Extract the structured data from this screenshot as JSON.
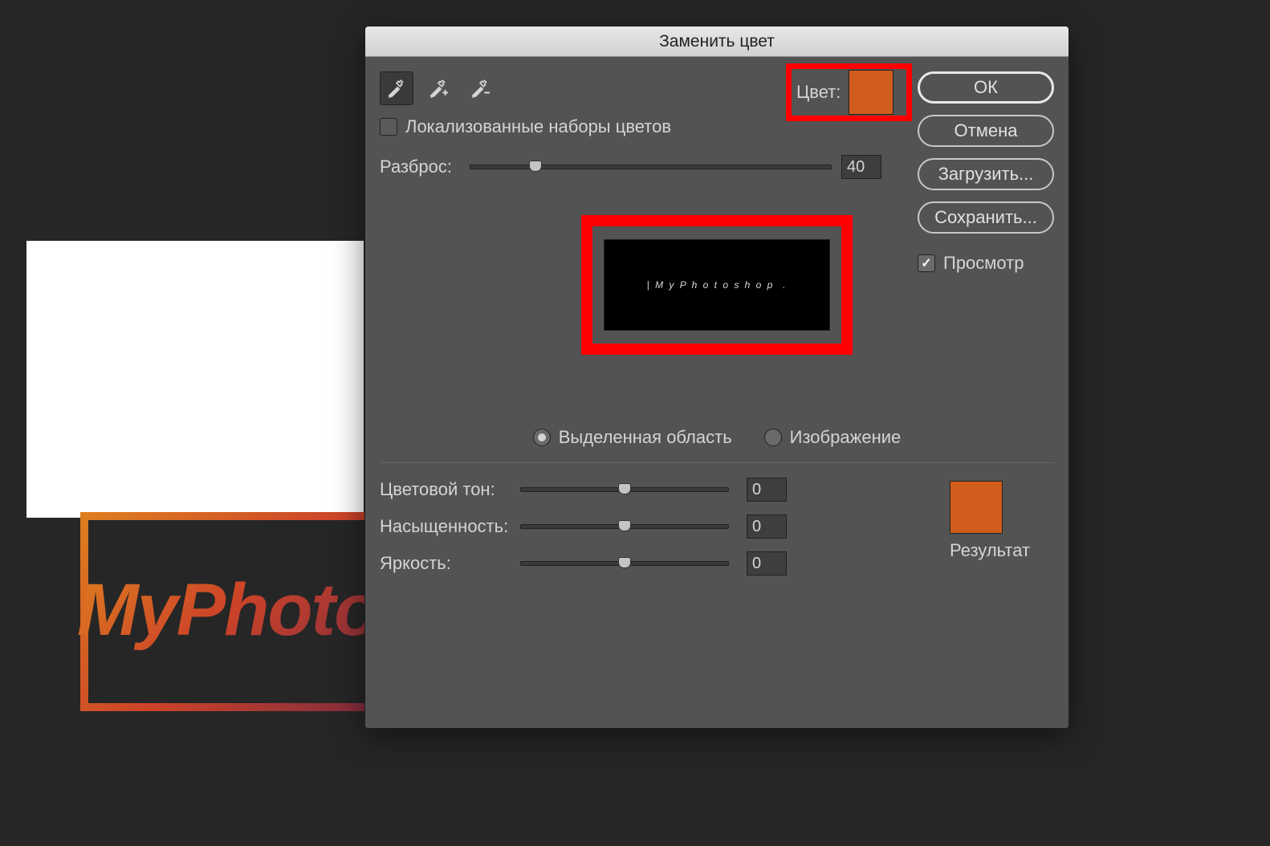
{
  "canvas": {
    "logo_text": "MyPhoto"
  },
  "dialog": {
    "title": "Заменить цвет",
    "eyedroppers": {
      "main": "eyedropper",
      "add": "eyedropper-add",
      "subtract": "eyedropper-subtract"
    },
    "localized_clusters": {
      "label": "Локализованные наборы цветов",
      "checked": false
    },
    "color": {
      "label": "Цвет:",
      "value": "#d05d1b"
    },
    "fuzziness": {
      "label": "Разброс:",
      "value": "40",
      "percent": 18
    },
    "preview_text": "MyPhotoshop",
    "mode": {
      "selection": {
        "label": "Выделенная область",
        "checked": true
      },
      "image": {
        "label": "Изображение",
        "checked": false
      }
    },
    "hsl": {
      "hue": {
        "label": "Цветовой тон:",
        "value": "0"
      },
      "saturation": {
        "label": "Насыщенность:",
        "value": "0"
      },
      "lightness": {
        "label": "Яркость:",
        "value": "0"
      }
    },
    "result": {
      "label": "Результат",
      "color": "#d05d1b"
    },
    "buttons": {
      "ok": "ОК",
      "cancel": "Отмена",
      "load": "Загрузить...",
      "save": "Сохранить..."
    },
    "preview_checkbox": {
      "label": "Просмотр",
      "checked": true
    }
  }
}
